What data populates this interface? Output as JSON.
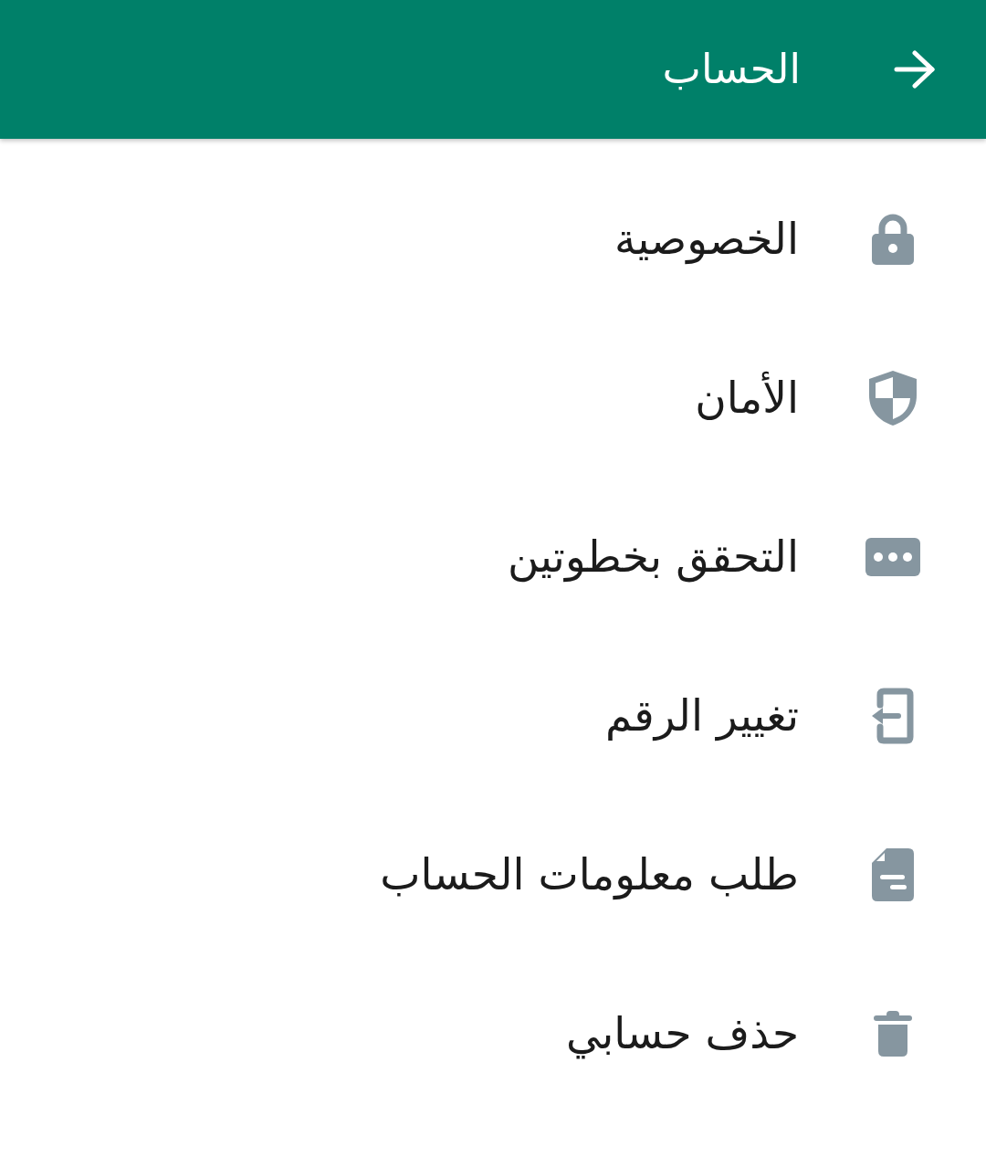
{
  "app_bar": {
    "title": "الحساب"
  },
  "items": [
    {
      "kind": "lock",
      "label": "الخصوصية"
    },
    {
      "kind": "shield",
      "label": "الأمان"
    },
    {
      "kind": "dots",
      "label": "التحقق بخطوتين"
    },
    {
      "kind": "change-number",
      "label": "تغيير الرقم"
    },
    {
      "kind": "document",
      "label": "طلب معلومات الحساب"
    },
    {
      "kind": "trash",
      "label": "حذف حسابي"
    }
  ]
}
